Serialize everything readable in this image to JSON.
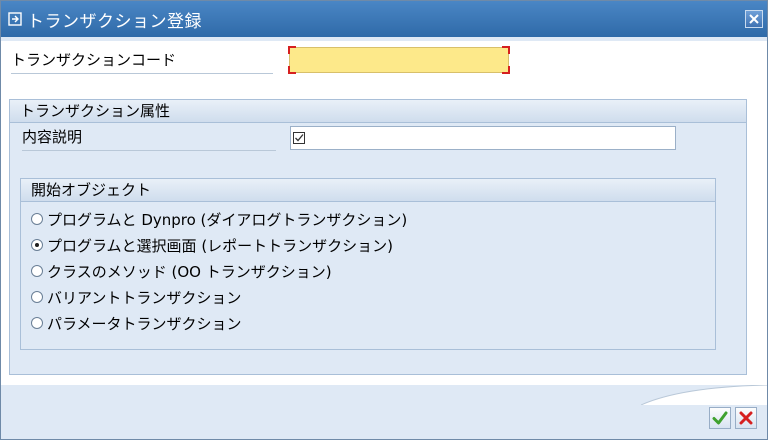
{
  "window": {
    "title": "トランザクション登録",
    "close_icon": "close-icon"
  },
  "tcode": {
    "label": "トランザクションコード",
    "value": ""
  },
  "attributes": {
    "header": "トランザクション属性",
    "description_label": "内容説明",
    "description_value": "",
    "description_icon": "checkbox-icon"
  },
  "start_object": {
    "header": "開始オブジェクト",
    "options": [
      {
        "label": "プログラムと Dynpro (ダイアログトランザクション)",
        "selected": false
      },
      {
        "label": "プログラムと選択画面 (レポートトランザクション)",
        "selected": true
      },
      {
        "label": "クラスのメソッド (OO トランザクション)",
        "selected": false
      },
      {
        "label": "バリアントトランザクション",
        "selected": false
      },
      {
        "label": "パラメータトランザクション",
        "selected": false
      }
    ]
  },
  "footer": {
    "ok_icon": "checkmark-icon",
    "cancel_icon": "cancel-icon"
  },
  "colors": {
    "titlebar": "#2f6aa8",
    "required_field": "#fde98a",
    "group_bg": "#dfe9f5",
    "ok_green": "#3fa12e",
    "cancel_red": "#d62020"
  }
}
